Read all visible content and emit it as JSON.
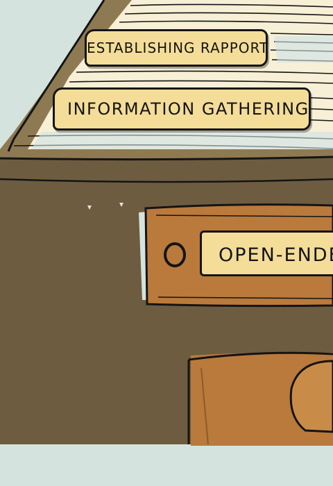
{
  "tabs": {
    "rapport_label": "Establishing Rapport",
    "information_label": "Information Gathering"
  },
  "drawer": {
    "label": "Open-Ended",
    "handle_icon": "ring-handle-icon"
  },
  "colors": {
    "background": "#d5e3de",
    "cabinet_dark": "#6e5c40",
    "cabinet_olive": "#8e7a52",
    "drawer_orange": "#b97a3c",
    "label_yellow": "#f4dd98",
    "paper": "#f7efd6",
    "ink": "#141414"
  }
}
